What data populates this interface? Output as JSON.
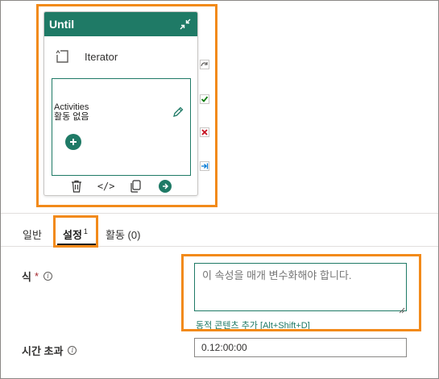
{
  "until": {
    "title": "Until",
    "iterator_label": "Iterator",
    "activities_title": "Activities",
    "activities_empty": "활동 없음",
    "add_icon": "plus",
    "toolbar_icons": [
      "trash-icon",
      "code-icon",
      "copy-icon",
      "arrow-right-icon"
    ]
  },
  "side_connectors": [
    "skip-icon",
    "success-check-icon",
    "failure-x-icon",
    "completion-arrow-icon"
  ],
  "tabs": {
    "general": "일반",
    "settings": "설정",
    "settings_badge": "1",
    "activities": "활동 (0)"
  },
  "form": {
    "expression_label": "식",
    "expression_required": "*",
    "expression_placeholder": "이 속성을 매개 변수화해야 합니다.",
    "dynamic_content_link": "동적 콘텐츠 추가 [Alt+Shift+D]",
    "timeout_label": "시간 초과",
    "timeout_value": "0.12:00:00"
  },
  "colors": {
    "accent": "#1f7a66",
    "highlight": "#f28a1a",
    "success": "#107c10",
    "failure": "#c50f1f",
    "completion": "#0078d4"
  }
}
